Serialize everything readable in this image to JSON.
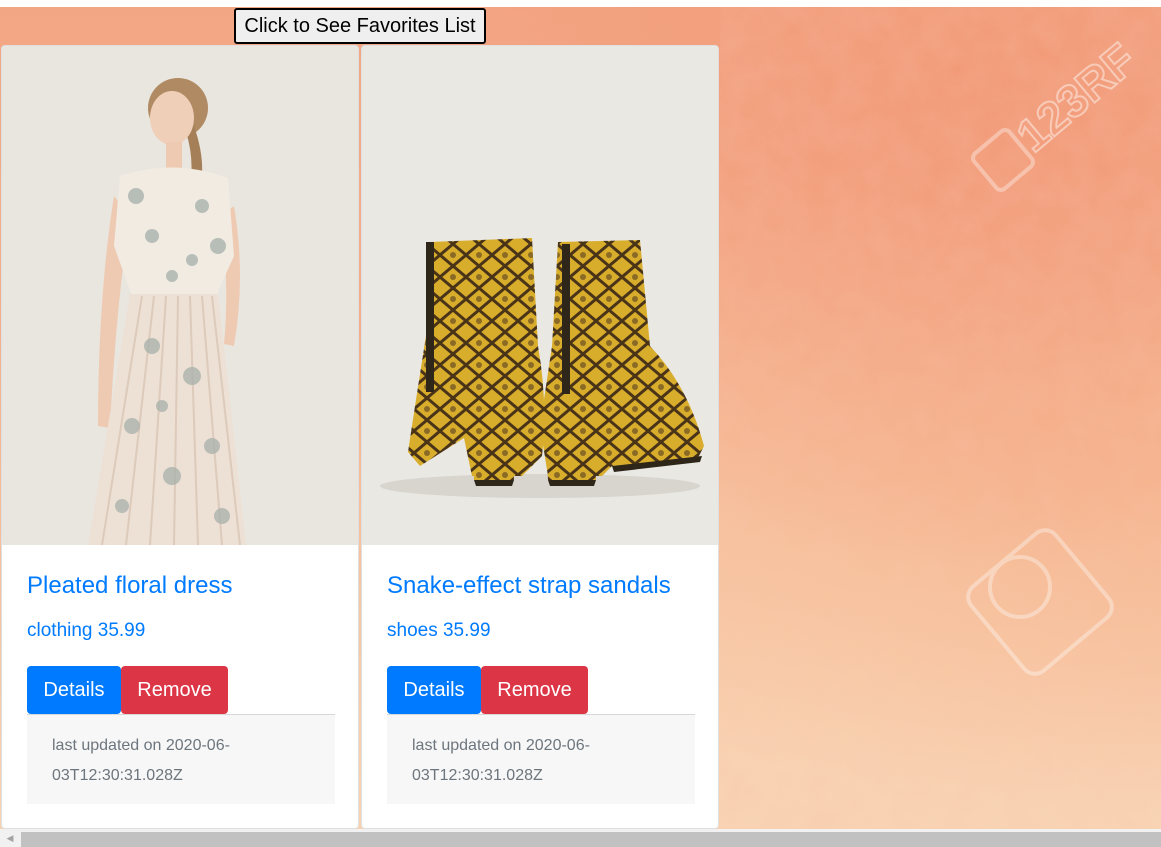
{
  "header": {
    "favorites_button_label": "Click to See Favorites List"
  },
  "products": [
    {
      "title": "Pleated floral dress",
      "category": "clothing",
      "price": "35.99",
      "subtitle": "clothing 35.99",
      "details_label": "Details",
      "remove_label": "Remove",
      "updated_text": "last updated on 2020-06-03T12:30:31.028Z",
      "updated_line1": "last updated on 2020-06-",
      "updated_line2": "03T12:30:31.028Z"
    },
    {
      "title": "Snake-effect strap sandals",
      "category": "shoes",
      "price": "35.99",
      "subtitle": "shoes 35.99",
      "details_label": "Details",
      "remove_label": "Remove",
      "updated_text": "last updated on 2020-06-03T12:30:31.028Z",
      "updated_line1": "last updated on 2020-06-",
      "updated_line2": "03T12:30:31.028Z"
    }
  ],
  "background": {
    "watermark_text": "123RF"
  },
  "colors": {
    "primary": "#007bff",
    "danger": "#dc3545",
    "background_peach": "#f4ae8c",
    "footer_bg": "#f7f7f7",
    "muted_text": "#6c757d"
  }
}
